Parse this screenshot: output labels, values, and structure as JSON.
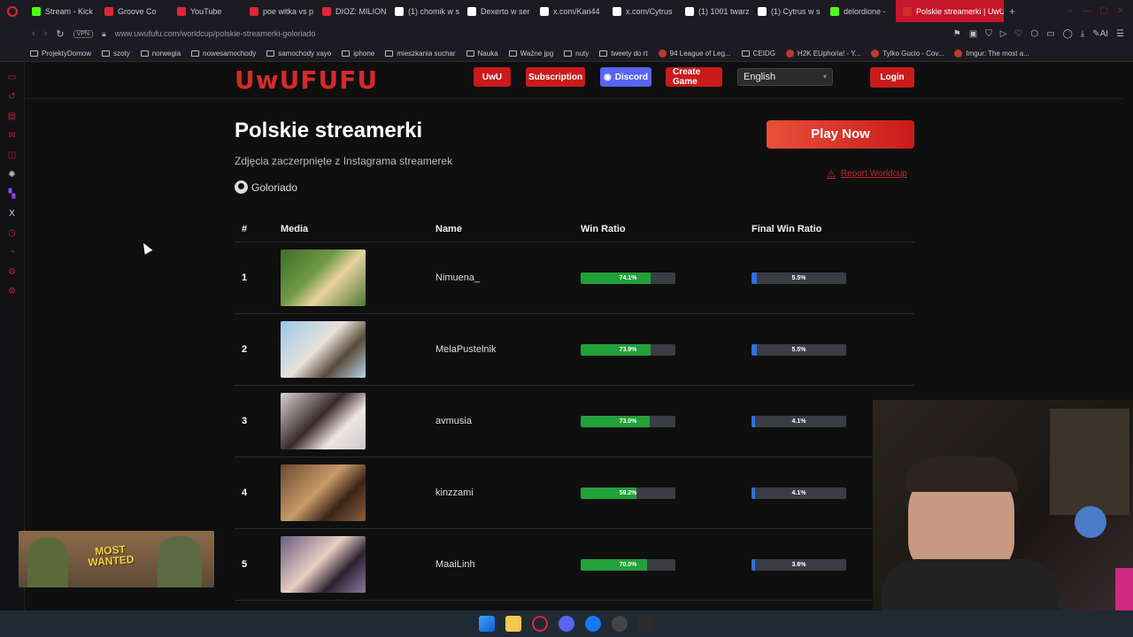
{
  "browser": {
    "tabs": [
      {
        "label": "Stream - Kick",
        "color": "#53fc18",
        "icon": "kick-icon"
      },
      {
        "label": "Groove Co",
        "color": "#e0243a",
        "icon": "youtube-icon"
      },
      {
        "label": "YouTube",
        "color": "#e0243a",
        "icon": "youtube-icon"
      },
      {
        "label": "poe witka vs p",
        "color": "#e0243a",
        "icon": "youtube-icon"
      },
      {
        "label": "DIOZ: MILION",
        "color": "#e0243a",
        "icon": "youtube-icon"
      },
      {
        "label": "(1) chomik w s",
        "color": "#ffffff",
        "icon": "x-icon"
      },
      {
        "label": "Dexerto w ser",
        "color": "#ffffff",
        "icon": "x-icon"
      },
      {
        "label": "x.com/Kari44",
        "color": "#ffffff",
        "icon": "x-icon"
      },
      {
        "label": "x.com/Cytrus",
        "color": "#ffffff",
        "icon": "x-icon"
      },
      {
        "label": "(1) 1001 twarz",
        "color": "#ffffff",
        "icon": "x-icon"
      },
      {
        "label": "(1) Cytrus w s",
        "color": "#ffffff",
        "icon": "x-icon"
      },
      {
        "label": "delordione -",
        "color": "#53fc18",
        "icon": "kick-icon"
      },
      {
        "label": "Polskie streamerki | UwU",
        "color": "#d42a2a",
        "icon": "uwufufu-icon"
      }
    ],
    "vpn": "VPN",
    "url": "www.uwufufu.com/worldcup/polskie-streamerki-goloriado",
    "bookmarks": [
      {
        "label": "ProjektyDomow",
        "type": "folder"
      },
      {
        "label": "szoty",
        "type": "folder"
      },
      {
        "label": "norwegia",
        "type": "folder"
      },
      {
        "label": "nowesamochody",
        "type": "folder"
      },
      {
        "label": "samochody xayo",
        "type": "folder"
      },
      {
        "label": "iphone",
        "type": "folder"
      },
      {
        "label": "mieszkania suchar",
        "type": "folder"
      },
      {
        "label": "Nauka",
        "type": "folder"
      },
      {
        "label": "Ważne jpg",
        "type": "folder"
      },
      {
        "label": "nuty",
        "type": "folder"
      },
      {
        "label": "tweety do rt",
        "type": "folder"
      },
      {
        "label": "94 League of Leg...",
        "type": "site"
      },
      {
        "label": "CEIDG",
        "type": "folder"
      },
      {
        "label": "H2K EUphoria! - Y...",
        "type": "site"
      },
      {
        "label": "Tylko Gucio - Cov...",
        "type": "site"
      },
      {
        "label": "Imgur: The most a...",
        "type": "site"
      }
    ]
  },
  "header": {
    "logo": "UwUFUFU",
    "uwu": "UwU",
    "subscription": "Subscription",
    "discord": "Discord",
    "create_game": "Create Game",
    "language": "English",
    "login": "Login"
  },
  "worldcup": {
    "title": "Polskie streamerki",
    "subtitle": "Zdjęcia zaczerpnięte z Instagrama streamerek",
    "author": "Goloriado",
    "play": "Play Now",
    "report": "Report Worldcup"
  },
  "table": {
    "headers": [
      "#",
      "Media",
      "Name",
      "Win Ratio",
      "Final Win Ratio"
    ],
    "rows": [
      {
        "rank": "1",
        "name": "Nimuena_",
        "win": "74.1%",
        "win_frac": 0.741,
        "final": "5.5%",
        "final_frac": 0.055
      },
      {
        "rank": "2",
        "name": "MelaPustelnik",
        "win": "73.9%",
        "win_frac": 0.739,
        "final": "5.5%",
        "final_frac": 0.055
      },
      {
        "rank": "3",
        "name": "avmusia",
        "win": "73.0%",
        "win_frac": 0.73,
        "final": "4.1%",
        "final_frac": 0.041
      },
      {
        "rank": "4",
        "name": "kinzzami",
        "win": "59.2%",
        "win_frac": 0.592,
        "final": "4.1%",
        "final_frac": 0.041
      },
      {
        "rank": "5",
        "name": "MaaiLinh",
        "win": "70.0%",
        "win_frac": 0.7,
        "final": "3.6%",
        "final_frac": 0.036
      }
    ]
  },
  "overlay": {
    "ad_text_1": "MOST",
    "ad_text_2": "WANTED"
  },
  "colors": {
    "brand": "#d42a2a",
    "win_bar": "#22a03a",
    "final_bar": "#2f6fe0",
    "discord": "#5865f2"
  }
}
